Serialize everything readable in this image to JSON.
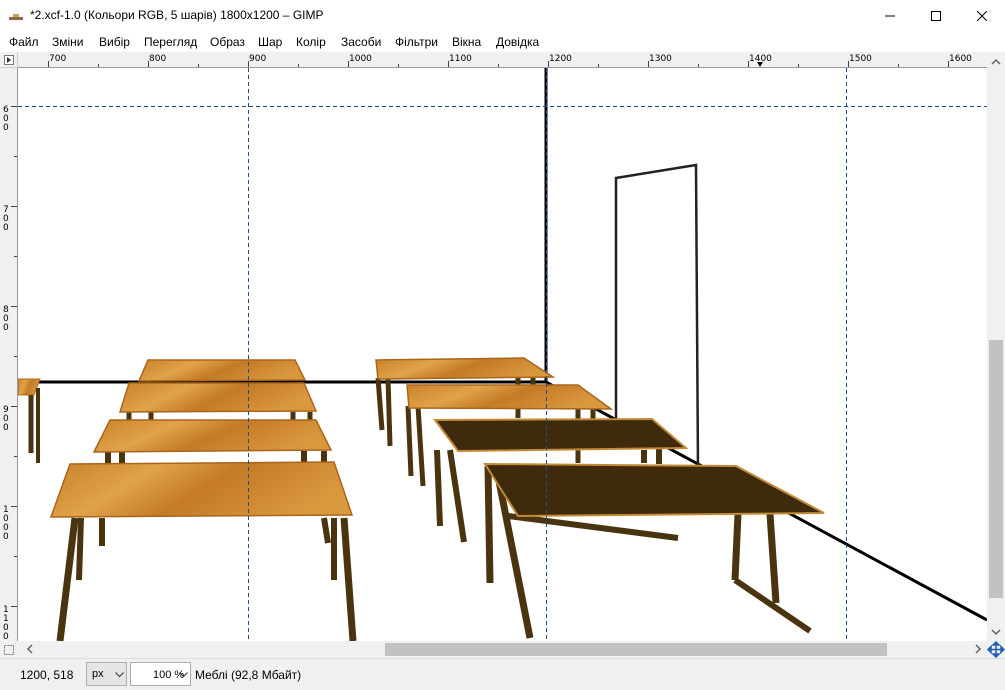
{
  "window": {
    "title": "*2.xcf-1.0 (Кольори RGB, 5 шарів) 1800x1200 – GIMP",
    "app_icon": "gimp-icon",
    "minimize_icon": "minimize-icon",
    "maximize_icon": "maximize-icon",
    "close_icon": "close-icon"
  },
  "menu": [
    "Файл",
    "Зміни",
    "Вибір",
    "Перегляд",
    "Образ",
    "Шар",
    "Колір",
    "Засоби",
    "Фільтри",
    "Вікна",
    "Довідка"
  ],
  "ruler": {
    "h_labels": [
      "700",
      "800",
      "900",
      "1000",
      "1100",
      "1200",
      "1300",
      "1400",
      "1500",
      "1600"
    ],
    "v_labels": [
      "600",
      "700",
      "800",
      "900",
      "1000",
      "1100"
    ]
  },
  "status": {
    "coords": "1200, 518",
    "unit": "px",
    "zoom": "100 %",
    "message": "Меблі (92,8 Мбайт)"
  },
  "colors": {
    "guide": "#1f4e8c",
    "wood_light": "#d08a2a",
    "wood_dark": "#3f2a0d",
    "legs": "#4a3410"
  }
}
